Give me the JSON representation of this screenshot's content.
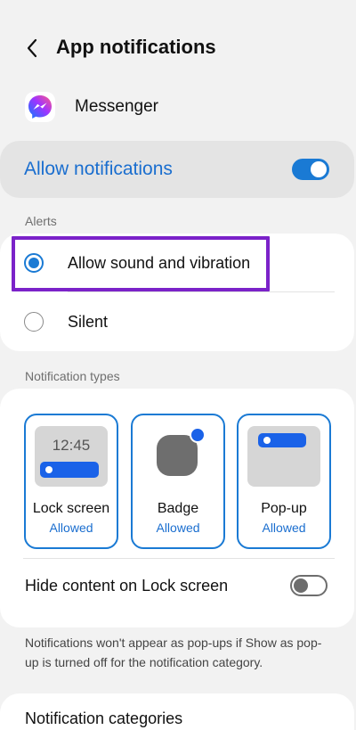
{
  "header": {
    "title": "App notifications"
  },
  "app": {
    "name": "Messenger"
  },
  "allow": {
    "label": "Allow notifications",
    "enabled": true
  },
  "alerts": {
    "section_label": "Alerts",
    "options": [
      {
        "label": "Allow sound and vibration",
        "selected": true
      },
      {
        "label": "Silent",
        "selected": false
      }
    ]
  },
  "notification_types": {
    "section_label": "Notification types",
    "tiles": [
      {
        "name": "Lock screen",
        "status": "Allowed",
        "clock": "12:45"
      },
      {
        "name": "Badge",
        "status": "Allowed"
      },
      {
        "name": "Pop-up",
        "status": "Allowed"
      }
    ],
    "hide_content": {
      "label": "Hide content on Lock screen",
      "enabled": false
    }
  },
  "footnote": "Notifications won't appear as pop-ups if Show as pop-up is turned off for the notification category.",
  "categories": {
    "label": "Notification categories"
  },
  "colors": {
    "accent": "#1a7ad4",
    "highlight": "#7b22c9",
    "background": "#f2f2f2"
  }
}
